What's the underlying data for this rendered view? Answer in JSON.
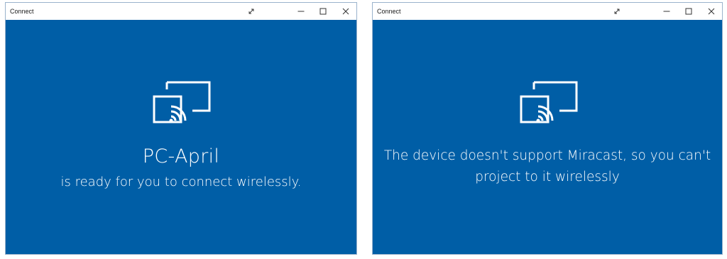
{
  "windows": [
    {
      "title": "Connect",
      "device_name": "PC-April",
      "message": "is ready for you to connect wirelessly."
    },
    {
      "title": "Connect",
      "message_line1": "The device doesn't support Miracast, so you can't",
      "message_line2": "project to it wirelessly"
    }
  ],
  "icons": {
    "expand": "expand-icon",
    "minimize": "minimize-icon",
    "maximize": "maximize-icon",
    "close": "close-icon",
    "cast": "cast-icon"
  },
  "colors": {
    "accent_background": "#005ea6",
    "text": "#ffffff",
    "titlebar": "#ffffff"
  }
}
